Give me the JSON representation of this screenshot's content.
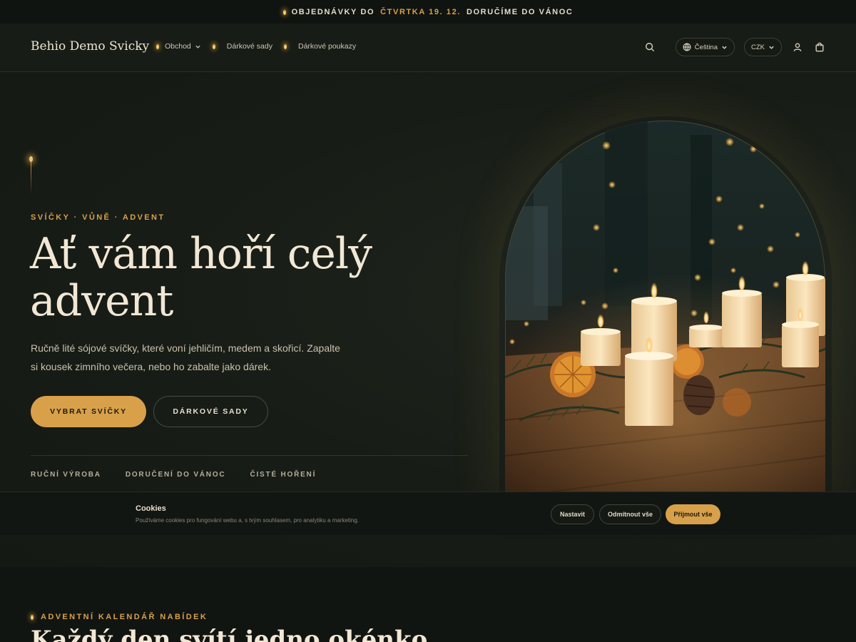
{
  "announcement": {
    "before": "OBJEDNÁVKY DO",
    "highlight": "ČTVRTKA 19. 12.",
    "after": "DORUČÍME DO VÁNOC"
  },
  "header": {
    "brand": "Behio Demo Svicky",
    "nav": [
      {
        "label": "Obchod",
        "has_dropdown": true
      },
      {
        "label": "Dárkové sady"
      },
      {
        "label": "Dárkové poukazy"
      }
    ],
    "language": "Čeština",
    "currency": "CZK",
    "icons": [
      "search-icon",
      "globe-icon",
      "user-icon",
      "cart-icon"
    ]
  },
  "hero": {
    "eyebrow": "SVÍČKY · VŮNĚ · ADVENT",
    "title": "Ať vám hoří celý advent",
    "lead": "Ručně lité sójové svíčky, které voní jehličím, medem a skořicí. Zapalte si kousek zimního večera, nebo ho zabalte jako dárek.",
    "primary_button": "VYBRAT SVÍČKY",
    "secondary_button": "DÁRKOVÉ SADY",
    "features": [
      "RUČNÍ VÝROBA",
      "DORUČENÍ DO VÁNOC",
      "ČISTÉ HOŘENÍ"
    ]
  },
  "cookie": {
    "title": "Cookies",
    "text": "Používáme cookies pro fungování webu a, s tvým souhlasem, pro analytiku a marketing.",
    "settings": "Nastavit",
    "reject": "Odmítnout vše",
    "accept": "Přijmout vše"
  },
  "section2": {
    "eyebrow": "ADVENTNÍ KALENDÁŘ NABÍDEK",
    "title": "Každý den svítí jedno okénko"
  },
  "colors": {
    "accent": "#d9a04a",
    "background": "#161a15",
    "text": "#ece3d0"
  }
}
